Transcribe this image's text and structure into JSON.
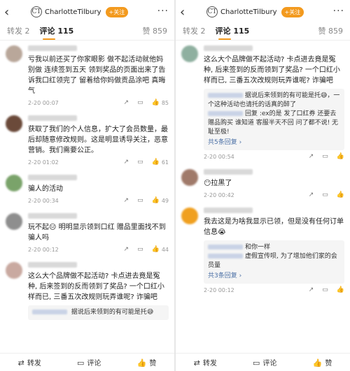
{
  "header": {
    "brand": "CharlotteTilbury",
    "follow": "+关注",
    "more": "···"
  },
  "tabs": [
    {
      "label": "转发 2"
    },
    {
      "label": "评论 115"
    }
  ],
  "likes_label": "赞 859",
  "left_comments": [
    {
      "text": "亏我以前还买了你家眼影 做不起活动就他妈别做 连续签到五天 领到奖品的页面出来了告诉我口红领完了 留着给你妈做贡品涂吧 真晦气",
      "time": "2-20 00:07",
      "likes": "85",
      "avatar_color": "#b9a79a"
    },
    {
      "text": "获取了我们的个人信息，扩大了会员数量，最后却随意修改规则。这是明显诱导关注，恶意营销。我们需要公正。",
      "time": "2-20 01:02",
      "likes": "61",
      "avatar_color": "#6b4a3a"
    },
    {
      "text": "骗人的活动",
      "time": "2-20 00:34",
      "likes": "49",
      "avatar_color": "#7aa36a"
    },
    {
      "text": "玩不起😑 明明显示领到口红 赠品里面找不到 骗人吗",
      "time": "2-20 00:12",
      "likes": "44",
      "avatar_color": "#8e8e8e"
    },
    {
      "text": "这么大个品牌做不起活动? 卡点进去竟是冤种, 后来签到的反而领到了奖品? 一个口红小样而已, 三番五次改规则玩弄谁呢? 诈骗吧",
      "time": "",
      "likes": "",
      "avatar_color": "#c9a9a0"
    }
  ],
  "left_reply_partial": "据说后来领到的有可能是托😅",
  "right_comments": [
    {
      "text": "这么大个品牌做不起活动? 卡点进去竟是冤种, 后来签到的反而领到了奖品? 一个口红小样而已, 三番五次改规则玩弄谁呢? 诈骗吧",
      "time": "2-20 00:54",
      "likes": "",
      "avatar_color": "#8fb0a0",
      "replies": [
        {
          "text": "据说后来领到的有可能是托😅，一个这种活动也请托的话真的醉了"
        },
        {
          "text": "回复 :ex的是 发了口红券 还要去赠品购买 谁知道 客服半天不回 问了都不说! 无耻至极!"
        }
      ],
      "more_replies": "共5条回复 ›"
    },
    {
      "text": "😶拉黑了",
      "time": "2-20 00:42",
      "likes": "",
      "avatar_color": "#a07a6a"
    },
    {
      "text": "我去这是为啥我显示已领，但是没有任何订单信息😭",
      "time": "2-20 00:12",
      "likes": "",
      "avatar_color": "#f0a020",
      "replies": [
        {
          "text": "和你一样"
        },
        {
          "text": "虚假宣传呗, 为了增加他们家的会员量"
        }
      ],
      "more_replies": "共3条回复 ›"
    }
  ],
  "bottom": {
    "repost": "转发",
    "comment": "评论",
    "like": "赞"
  }
}
